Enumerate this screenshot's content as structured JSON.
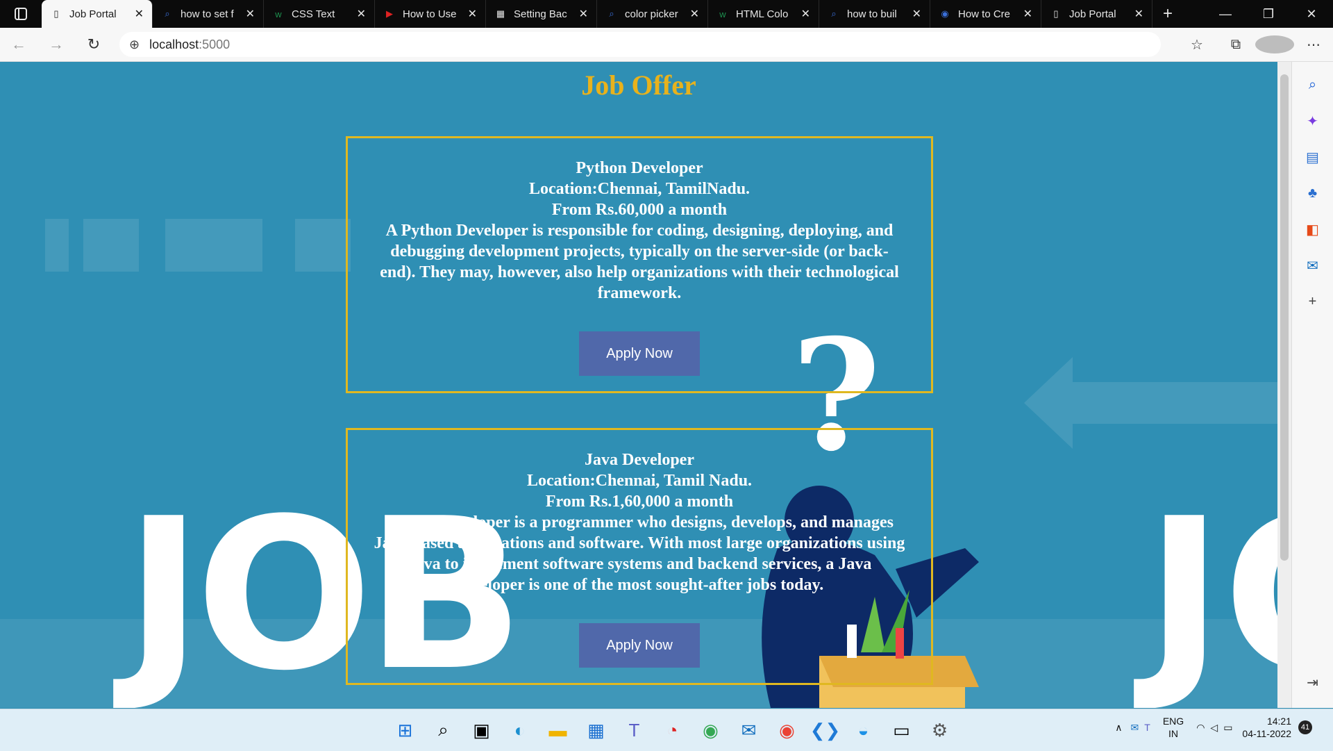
{
  "browser": {
    "tabs": [
      {
        "title": "Job Portal",
        "icon": "page-icon",
        "active": true
      },
      {
        "title": "how to set f",
        "icon": "search-icon"
      },
      {
        "title": "CSS Text",
        "icon": "w3-icon"
      },
      {
        "title": "How to Use",
        "icon": "video-icon"
      },
      {
        "title": "Setting Bac",
        "icon": "site-icon"
      },
      {
        "title": "color picker",
        "icon": "search-icon"
      },
      {
        "title": "HTML Colo",
        "icon": "w3-icon"
      },
      {
        "title": "how to buil",
        "icon": "search-icon"
      },
      {
        "title": "How to Cre",
        "icon": "globe-icon"
      },
      {
        "title": "Job Portal",
        "icon": "page-icon"
      }
    ],
    "url_host": "localhost",
    "url_port": ":5000"
  },
  "page": {
    "heading": "Job Offer",
    "jobs": [
      {
        "title": "Python Developer",
        "location": "Location:Chennai, TamilNadu.",
        "salary": "From Rs.60,000 a month",
        "description": "A Python Developer is responsible for coding, designing, deploying, and debugging development projects, typically on the server-side (or back-end). They may, however, also help organizations with their technological framework.",
        "button": "Apply Now"
      },
      {
        "title": "Java Developer",
        "location": "Location:Chennai, Tamil Nadu.",
        "salary": "From Rs.1,60,000 a month",
        "description": "A Java Developer is a programmer who designs, develops, and manages Java-based applications and software. With most large organizations using Java to implement software systems and backend services, a Java developer is one of the most sought-after jobs today.",
        "button": "Apply Now"
      }
    ],
    "background": {
      "big_word": "JOB",
      "big_word_right": "JO",
      "question": "?"
    },
    "colors": {
      "bg": "#2f8fb4",
      "heading": "#e8b21c",
      "border": "#e0b820",
      "button": "#5068aa"
    }
  },
  "taskbar": {
    "lang": "ENG",
    "region": "IN",
    "time": "14:21",
    "date": "04-11-2022",
    "notifications": "41"
  }
}
